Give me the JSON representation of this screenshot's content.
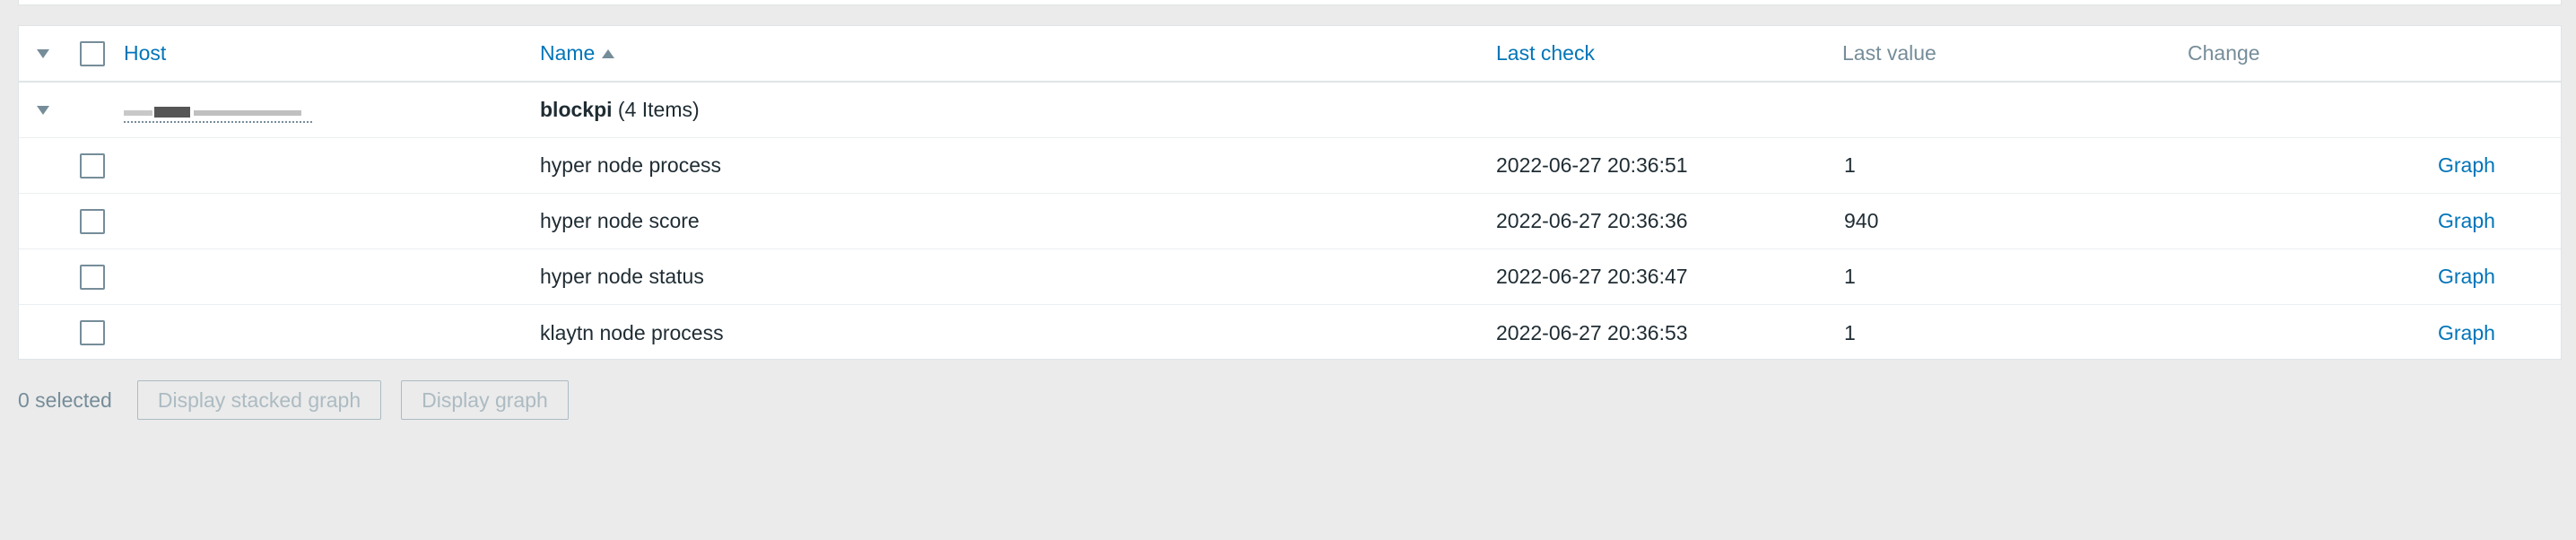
{
  "table": {
    "headers": {
      "host": "Host",
      "name": "Name",
      "last_check": "Last check",
      "last_value": "Last value",
      "change": "Change"
    },
    "group": {
      "name": "blockpi",
      "count_label": "(4 Items)"
    },
    "rows": [
      {
        "name": "hyper node process",
        "last_check": "2022-06-27 20:36:51",
        "last_value": "1",
        "action": "Graph"
      },
      {
        "name": "hyper node score",
        "last_check": "2022-06-27 20:36:36",
        "last_value": "940",
        "action": "Graph"
      },
      {
        "name": "hyper node status",
        "last_check": "2022-06-27 20:36:47",
        "last_value": "1",
        "action": "Graph"
      },
      {
        "name": "klaytn node process",
        "last_check": "2022-06-27 20:36:53",
        "last_value": "1",
        "action": "Graph"
      }
    ]
  },
  "footer": {
    "selected": "0 selected",
    "stacked_graph_label": "Display stacked graph",
    "graph_label": "Display graph"
  },
  "colors": {
    "link": "#0275b8",
    "muted": "#768d99",
    "background": "#ebebeb"
  },
  "icons": {
    "collapse": "triangle-down",
    "sort": "triangle-up"
  }
}
